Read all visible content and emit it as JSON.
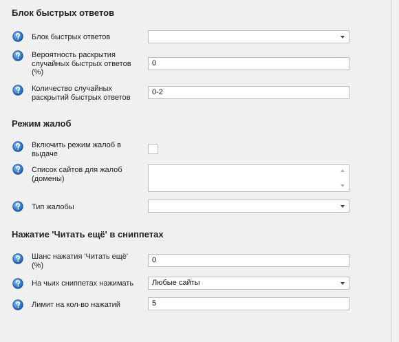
{
  "sections": {
    "quick_answers": {
      "title": "Блок быстрых ответов",
      "rows": {
        "block": {
          "label": "Блок быстрых ответов",
          "value": ""
        },
        "probability": {
          "label": "Вероятность раскрытия случайных быстрых ответов (%)",
          "value": "0"
        },
        "count": {
          "label": "Количество случайных раскрытий быстрых ответов",
          "value": "0-2"
        }
      }
    },
    "complaints": {
      "title": "Режим жалоб",
      "rows": {
        "enable": {
          "label": "Включить режим жалоб в выдаче",
          "checked": false
        },
        "sites": {
          "label": "Список сайтов для жалоб (домены)",
          "value": ""
        },
        "type": {
          "label": "Тип жалобы",
          "value": ""
        }
      }
    },
    "read_more": {
      "title": "Нажатие 'Читать ещё' в сниппетах",
      "rows": {
        "chance": {
          "label": "Шанс нажатия 'Читать ещё' (%)",
          "value": "0"
        },
        "which": {
          "label": "На чьих сниппетах нажимать",
          "value": "Любые сайты"
        },
        "limit": {
          "label": "Лимит на кол-во нажатий",
          "value": "5"
        }
      }
    }
  },
  "icons": {
    "help": "question-circle-icon",
    "help_color": "#3a78c3"
  }
}
